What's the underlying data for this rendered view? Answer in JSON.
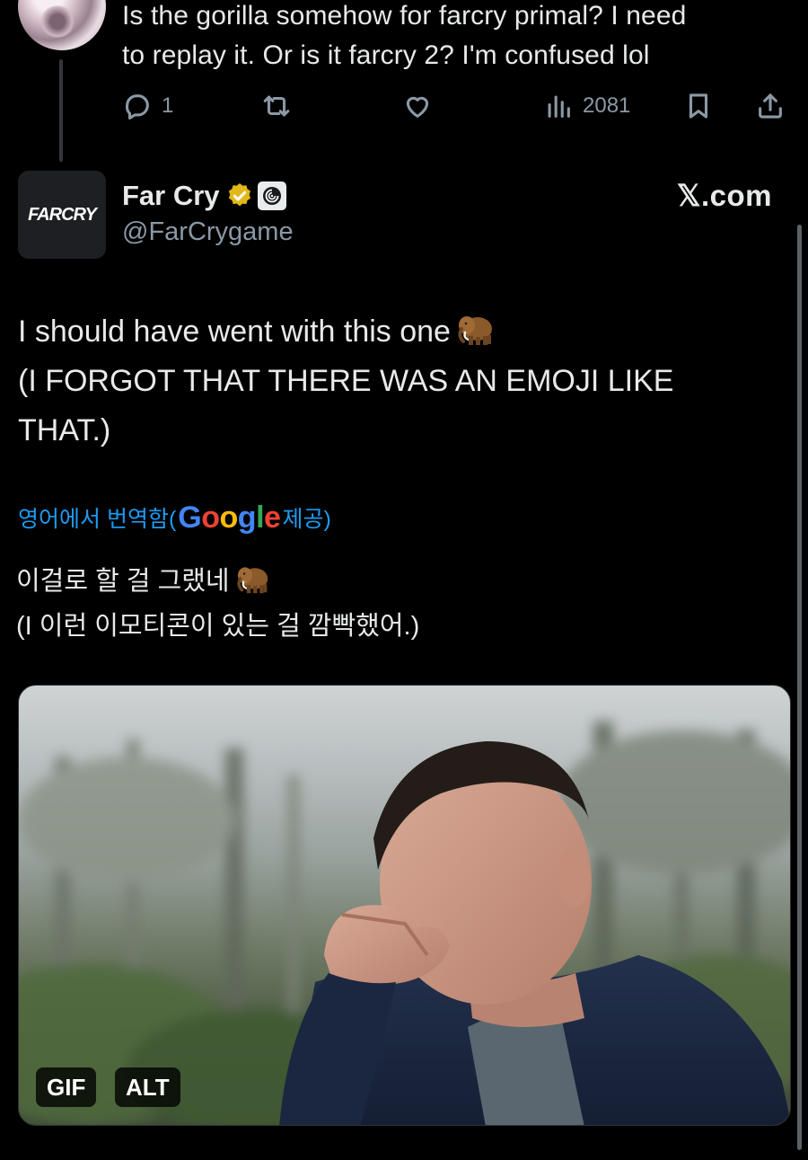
{
  "reply": {
    "text_line1": "Is the gorilla somehow for farcry primal? I need",
    "text_line2": "to replay it. Or is it farcry 2? I'm confused lol",
    "reply_count": "1",
    "view_count": "2081"
  },
  "author": {
    "display_name": "Far Cry",
    "handle": "@FarCrygame",
    "avatar_text": "FARCRY"
  },
  "watermark": "𝕏.com",
  "tweet": {
    "line1": "I should have went with this one",
    "line2": "(I FORGOT THAT THERE WAS AN EMOJI LIKE",
    "line3": "THAT.)"
  },
  "translation": {
    "prefix": "영어에서 번역함(",
    "google": {
      "g1": "G",
      "g2": "o",
      "g3": "o",
      "g4": "g",
      "g5": "l",
      "g6": "e"
    },
    "suffix": " 제공)",
    "line1": "이걸로 할 걸 그랬네",
    "line2": "(I 이런 이모티콘이 있는 걸 깜빡했어.)"
  },
  "media": {
    "gif_label": "GIF",
    "alt_label": "ALT"
  },
  "colors": {
    "background": "#000000",
    "text": "#e7e9ea",
    "muted": "#8b98a5",
    "link": "#1d9bf0",
    "verified_gold": "#e2b719"
  },
  "icons": [
    "reply-icon",
    "retweet-icon",
    "like-icon",
    "views-icon",
    "bookmark-icon",
    "share-icon",
    "verified-badge-icon",
    "ubisoft-affiliate-icon",
    "mammoth-emoji-icon"
  ]
}
